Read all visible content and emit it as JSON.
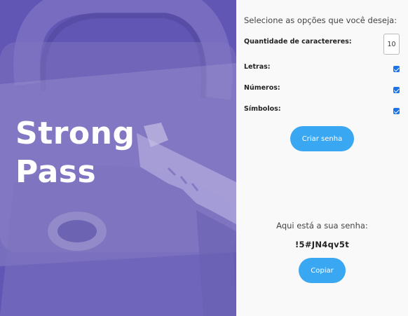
{
  "hero": {
    "title_line1": "Strong",
    "title_line2": "Pass",
    "image": "padlock-with-key",
    "overlay_color": "#6156b3"
  },
  "form": {
    "intro": "Selecione as opções que você deseja:",
    "quantity_label": "Quantidade de caractereres:",
    "quantity_value": "10",
    "letters_label": "Letras:",
    "letters_checked": true,
    "numbers_label": "Números:",
    "numbers_checked": true,
    "symbols_label": "Símbolos:",
    "symbols_checked": true,
    "create_button": "Criar senha"
  },
  "result": {
    "label": "Aqui está a sua senha:",
    "password": "!5#JN4qv5t",
    "copy_button": "Copiar"
  },
  "colors": {
    "accent": "#3aa7f2",
    "checkbox": "#1a73e8",
    "panel_bg": "#f9f9f9"
  }
}
